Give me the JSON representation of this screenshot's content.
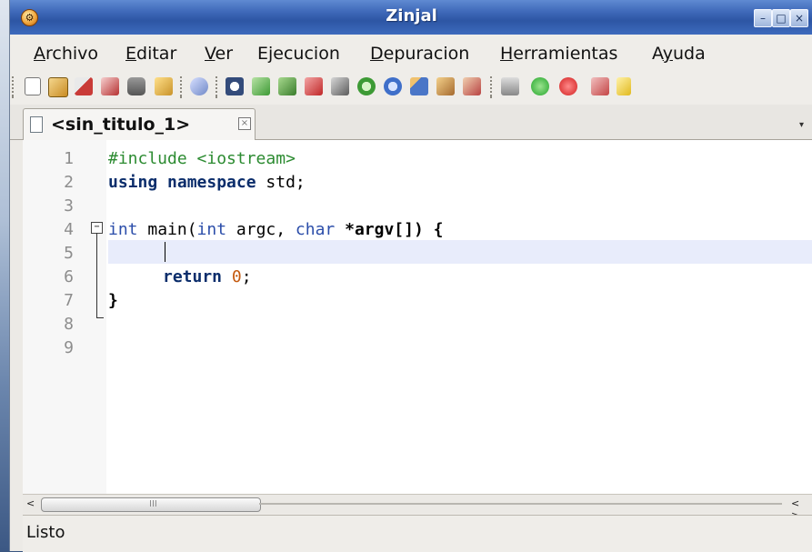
{
  "window": {
    "title": "Zinjal",
    "minimize_symbol": "–",
    "maximize_symbol": "□",
    "close_symbol": "×"
  },
  "menu": {
    "items": [
      {
        "label": "Archivo",
        "mnemonic": "A"
      },
      {
        "label": "Editar",
        "mnemonic": "E"
      },
      {
        "label": "Ver",
        "mnemonic": "V"
      },
      {
        "label": "Ejecucion",
        "mnemonic": "j"
      },
      {
        "label": "Depuracion",
        "mnemonic": "D"
      },
      {
        "label": "Herramientas",
        "mnemonic": "H"
      },
      {
        "label": "Ayuda",
        "mnemonic": "y"
      }
    ]
  },
  "toolbar": {
    "tools": [
      {
        "name": "new-file-icon",
        "color": "#ffffff"
      },
      {
        "name": "open-folder-icon",
        "color": "#d6a23a"
      },
      {
        "name": "save-icon",
        "color": "#c93b37"
      },
      {
        "name": "save-as-icon",
        "color": "#c93b37"
      },
      {
        "name": "print-icon",
        "color": "#6a6a6a"
      },
      {
        "name": "project-icon",
        "color": "#e3b73c"
      },
      {
        "name": "cut-icon",
        "color": "#6d7da8"
      },
      {
        "name": "find-icon",
        "color": "#334b7a"
      },
      {
        "name": "find-next-icon",
        "color": "#3d9a35"
      },
      {
        "name": "bookmark-icon",
        "color": "#4e9d39"
      },
      {
        "name": "clear-icon",
        "color": "#c02727"
      },
      {
        "name": "comment-icon",
        "color": "#5b5b5b"
      },
      {
        "name": "goto-line-icon",
        "color": "#3d9a35"
      },
      {
        "name": "goto-function-icon",
        "color": "#3f6fc9"
      },
      {
        "name": "include-icon",
        "color": "#4a76c7"
      },
      {
        "name": "compile-icon",
        "color": "#a56a2f"
      },
      {
        "name": "debug-icon",
        "color": "#b84242"
      },
      {
        "name": "binary-icon",
        "color": "#6a6a6a"
      },
      {
        "name": "run-icon",
        "color": "#25a62c"
      },
      {
        "name": "stop-icon",
        "color": "#d21f1f"
      },
      {
        "name": "tools-icon",
        "color": "#c44545"
      },
      {
        "name": "checklist-icon",
        "color": "#e1b91e"
      }
    ]
  },
  "tabs": [
    {
      "label": "<sin_titulo_1>",
      "close": "×"
    }
  ],
  "tab_menu_arrow": "▾",
  "editor": {
    "lines": [
      {
        "num": "1",
        "code": "#include <iostream>"
      },
      {
        "num": "2",
        "kw": "using namespace",
        "rest": " std;"
      },
      {
        "num": "3"
      },
      {
        "num": "4",
        "type1": "int",
        "mid": " main(",
        "type2": "int",
        "mid2": " argc, ",
        "type3": "char",
        "mid3": " *argv[]) {"
      },
      {
        "num": "5"
      },
      {
        "num": "6",
        "kw": "return",
        "value": "0",
        "end": ";"
      },
      {
        "num": "7",
        "code": "}"
      },
      {
        "num": "8"
      },
      {
        "num": "9"
      }
    ],
    "fold_symbol": "−"
  },
  "scrollbar": {
    "left_arrow": "<",
    "grip": "III",
    "right_arrows": "< >"
  },
  "status": {
    "text": "Listo"
  }
}
